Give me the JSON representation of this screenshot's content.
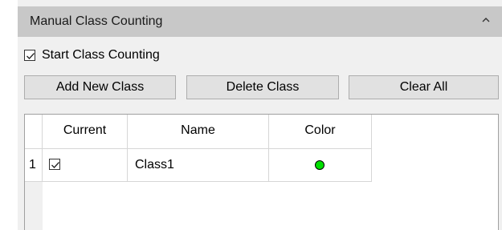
{
  "panel": {
    "title": "Manual Class Counting",
    "collapse_icon": "chevron-up-icon"
  },
  "start_counting": {
    "label": "Start Class Counting",
    "checked": true
  },
  "buttons": {
    "add": "Add New Class",
    "delete": "Delete Class",
    "clear": "Clear All"
  },
  "table": {
    "columns": [
      "Current",
      "Name",
      "Color"
    ],
    "rows": [
      {
        "index": "1",
        "current": true,
        "name": "Class1",
        "color": "#00e000"
      }
    ]
  },
  "colors": {
    "header_bg": "#c8c8c8",
    "panel_bg": "#f0f0f0",
    "button_bg": "#e1e1e1",
    "class1_color": "#00e000"
  }
}
